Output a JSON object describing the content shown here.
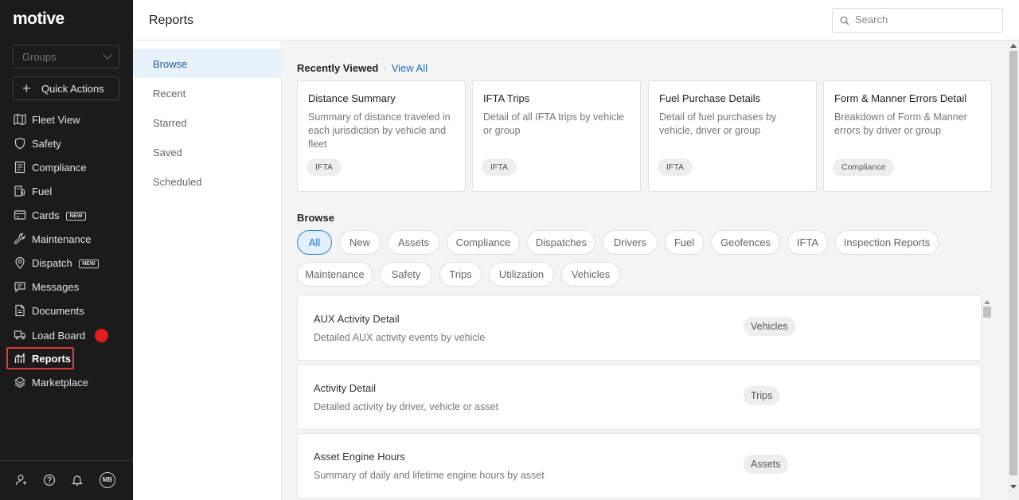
{
  "brand": {
    "logo": "motive"
  },
  "sidebar": {
    "groups_placeholder": "Groups",
    "quick_actions_label": "Quick Actions",
    "items": [
      {
        "label": "Fleet View",
        "icon": "map-icon"
      },
      {
        "label": "Safety",
        "icon": "shield-icon"
      },
      {
        "label": "Compliance",
        "icon": "document-list-icon"
      },
      {
        "label": "Fuel",
        "icon": "fuel-pump-icon"
      },
      {
        "label": "Cards",
        "icon": "credit-card-icon",
        "badge": "NEW"
      },
      {
        "label": "Maintenance",
        "icon": "wrench-icon"
      },
      {
        "label": "Dispatch",
        "icon": "location-pin-icon",
        "badge": "NEW"
      },
      {
        "label": "Messages",
        "icon": "chat-icon"
      },
      {
        "label": "Documents",
        "icon": "file-icon"
      },
      {
        "label": "Load Board",
        "icon": "truck-icon"
      },
      {
        "label": "Reports",
        "icon": "bar-chart-icon",
        "active": true
      },
      {
        "label": "Marketplace",
        "icon": "layers-icon"
      }
    ],
    "avatar_initials": "MB",
    "notification_dot_color": "#e21b1b"
  },
  "header": {
    "title": "Reports",
    "search_placeholder": "Search"
  },
  "subnav": {
    "items": [
      "Browse",
      "Recent",
      "Starred",
      "Saved",
      "Scheduled"
    ],
    "active": "Browse"
  },
  "recently_viewed": {
    "heading": "Recently Viewed",
    "view_all": "View All",
    "cards": [
      {
        "title": "Distance Summary",
        "desc": "Summary of distance traveled in each jurisdiction by vehicle and fleet",
        "tag": "IFTA"
      },
      {
        "title": "IFTA Trips",
        "desc": "Detail of all IFTA trips by vehicle or group",
        "tag": "IFTA"
      },
      {
        "title": "Fuel Purchase Details",
        "desc": "Detail of fuel purchases by vehicle, driver or group",
        "tag": "IFTA"
      },
      {
        "title": "Form & Manner Errors Detail",
        "desc": "Breakdown of Form & Manner errors by driver or group",
        "tag": "Compliance"
      }
    ]
  },
  "browse": {
    "heading": "Browse",
    "chips": [
      "All",
      "New",
      "Assets",
      "Compliance",
      "Dispatches",
      "Drivers",
      "Fuel",
      "Geofences",
      "IFTA",
      "Inspection Reports",
      "Maintenance",
      "Safety",
      "Trips",
      "Utilization",
      "Vehicles"
    ],
    "active_chip": "All",
    "reports": [
      {
        "title": "AUX Activity Detail",
        "desc": "Detailed AUX activity events by vehicle",
        "tag": "Vehicles"
      },
      {
        "title": "Activity Detail",
        "desc": "Detailed activity by driver, vehicle or asset",
        "tag": "Trips"
      },
      {
        "title": "Asset Engine Hours",
        "desc": "Summary of daily and lifetime engine hours by asset",
        "tag": "Assets"
      }
    ]
  },
  "colors": {
    "sidebar_bg": "#1b1b1b",
    "accent_blue": "#1f6fc1",
    "active_outline": "#e03a3a"
  }
}
